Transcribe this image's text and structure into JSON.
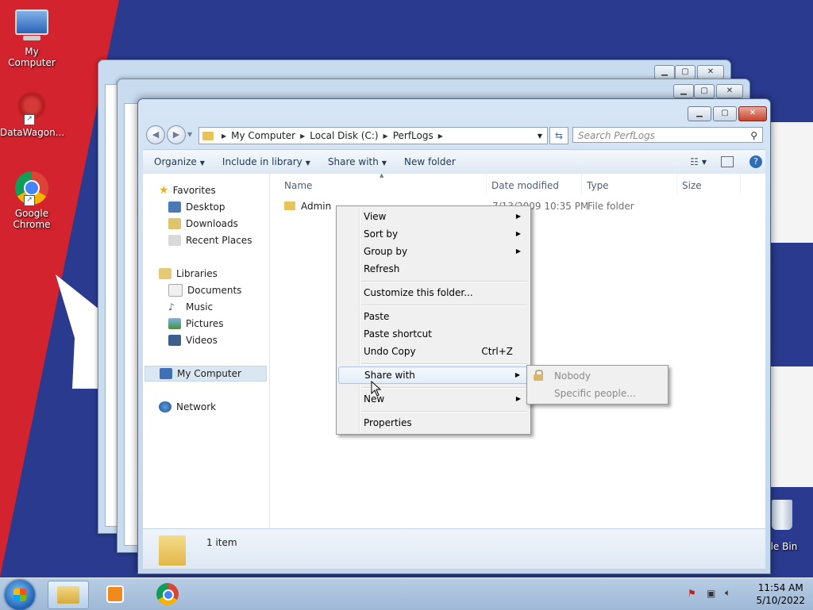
{
  "desktop": {
    "icons": [
      {
        "label": "My Computer"
      },
      {
        "label": "DataWagon..."
      },
      {
        "label": "Google Chrome"
      }
    ],
    "recycle_bin_label": "cle Bin"
  },
  "explorer": {
    "breadcrumb": [
      "My Computer",
      "Local Disk (C:)",
      "PerfLogs"
    ],
    "search_placeholder": "Search PerfLogs",
    "toolbar": {
      "organize": "Organize",
      "include_in_library": "Include in library",
      "share_with": "Share with",
      "new_folder": "New folder"
    },
    "nav": {
      "favorites": "Favorites",
      "desktop": "Desktop",
      "downloads": "Downloads",
      "recent_places": "Recent Places",
      "libraries": "Libraries",
      "documents": "Documents",
      "music": "Music",
      "pictures": "Pictures",
      "videos": "Videos",
      "my_computer": "My Computer",
      "network": "Network"
    },
    "columns": {
      "name": "Name",
      "date_modified": "Date modified",
      "type": "Type",
      "size": "Size"
    },
    "file": {
      "name": "Admin",
      "date_modified_visible": "7/13/2009 10:35 PM",
      "type": "File folder"
    },
    "status": "1 item"
  },
  "context_menu": {
    "items": {
      "view": "View",
      "sort_by": "Sort by",
      "group_by": "Group by",
      "refresh": "Refresh",
      "customize": "Customize this folder...",
      "paste": "Paste",
      "paste_shortcut": "Paste shortcut",
      "undo_copy": "Undo Copy",
      "undo_copy_shortcut": "Ctrl+Z",
      "share_with": "Share with",
      "new": "New",
      "properties": "Properties"
    },
    "submenu": {
      "nobody": "Nobody",
      "specific_people": "Specific people..."
    }
  },
  "taskbar": {
    "time": "11:54 AM",
    "date": "5/10/2022"
  },
  "colors": {
    "desktop_blue": "#2a3a8e",
    "desktop_red": "#d2232e"
  }
}
